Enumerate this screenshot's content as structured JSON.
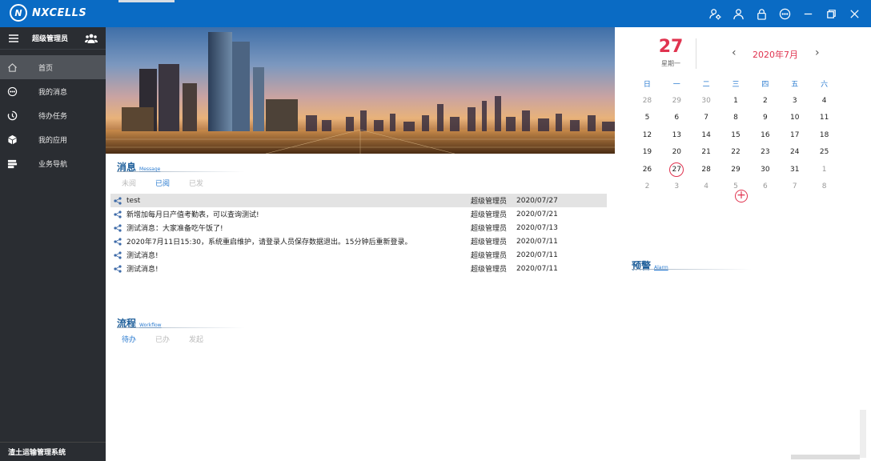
{
  "app": {
    "logo_text": "NXCELLS",
    "logo_badge": "N",
    "footer_title": "渣土运输管理系统"
  },
  "sidebar": {
    "user_name": "超级管理员",
    "items": [
      {
        "label": "首页",
        "icon": "home-icon",
        "active": true
      },
      {
        "label": "我的消息",
        "icon": "chat-icon"
      },
      {
        "label": "待办任务",
        "icon": "timer-icon"
      },
      {
        "label": "我的应用",
        "icon": "cube-icon"
      },
      {
        "label": "业务导航",
        "icon": "navigation-icon"
      }
    ]
  },
  "titlebar": {
    "icons": [
      "user-settings-icon",
      "user-icon",
      "lock-icon",
      "more-icon",
      "minimize-icon",
      "restore-icon",
      "close-icon"
    ]
  },
  "messages": {
    "title": "消息",
    "subtitle": "Message",
    "tabs": [
      "未阅",
      "已阅",
      "已发"
    ],
    "active_tab": 1,
    "rows": [
      {
        "title": "test",
        "sender": "超级管理员",
        "date": "2020/07/27"
      },
      {
        "title": "新增加每月日产值考勤表，可以查询测试!",
        "sender": "超级管理员",
        "date": "2020/07/21"
      },
      {
        "title": "测试消息：大家准备吃午饭了!",
        "sender": "超级管理员",
        "date": "2020/07/13"
      },
      {
        "title": " 2020年7月11日15:30，系统重启维护，请登录人员保存数据退出。15分钟后重新登录。",
        "sender": "超级管理员",
        "date": "2020/07/11"
      },
      {
        "title": "测试消息!",
        "sender": "超级管理员",
        "date": "2020/07/11"
      },
      {
        "title": "测试消息!",
        "sender": "超级管理员",
        "date": "2020/07/11"
      }
    ]
  },
  "workflow": {
    "title": "流程",
    "subtitle": "Workflow",
    "tabs": [
      "待办",
      "已办",
      "发起"
    ],
    "active_tab": 0
  },
  "alarm": {
    "title": "预警",
    "subtitle": "Alarm"
  },
  "calendar": {
    "big_day": "27",
    "weekday": "星期一",
    "month_label": "2020年7月",
    "prev": "‹",
    "next": "›",
    "add": "+",
    "headers": [
      "日",
      "一",
      "二",
      "三",
      "四",
      "五",
      "六"
    ],
    "weeks": [
      [
        {
          "d": "28",
          "o": true
        },
        {
          "d": "29",
          "o": true
        },
        {
          "d": "30",
          "o": true
        },
        {
          "d": "1"
        },
        {
          "d": "2"
        },
        {
          "d": "3"
        },
        {
          "d": "4"
        }
      ],
      [
        {
          "d": "5"
        },
        {
          "d": "6"
        },
        {
          "d": "7"
        },
        {
          "d": "8"
        },
        {
          "d": "9"
        },
        {
          "d": "10"
        },
        {
          "d": "11"
        }
      ],
      [
        {
          "d": "12"
        },
        {
          "d": "13"
        },
        {
          "d": "14"
        },
        {
          "d": "15"
        },
        {
          "d": "16"
        },
        {
          "d": "17"
        },
        {
          "d": "18"
        }
      ],
      [
        {
          "d": "19"
        },
        {
          "d": "20"
        },
        {
          "d": "21"
        },
        {
          "d": "22"
        },
        {
          "d": "23"
        },
        {
          "d": "24"
        },
        {
          "d": "25"
        }
      ],
      [
        {
          "d": "26"
        },
        {
          "d": "27",
          "t": true
        },
        {
          "d": "28"
        },
        {
          "d": "29"
        },
        {
          "d": "30"
        },
        {
          "d": "31"
        },
        {
          "d": "1",
          "o": true
        }
      ],
      [
        {
          "d": "2",
          "o": true
        },
        {
          "d": "3",
          "o": true
        },
        {
          "d": "4",
          "o": true
        },
        {
          "d": "5",
          "o": true
        },
        {
          "d": "6",
          "o": true
        },
        {
          "d": "7",
          "o": true
        },
        {
          "d": "8",
          "o": true
        }
      ]
    ]
  },
  "colors": {
    "titlebar": "#0a6bc4",
    "sidebar": "#2a2d32",
    "accent": "#2a7bd0",
    "today": "#e0334f"
  }
}
